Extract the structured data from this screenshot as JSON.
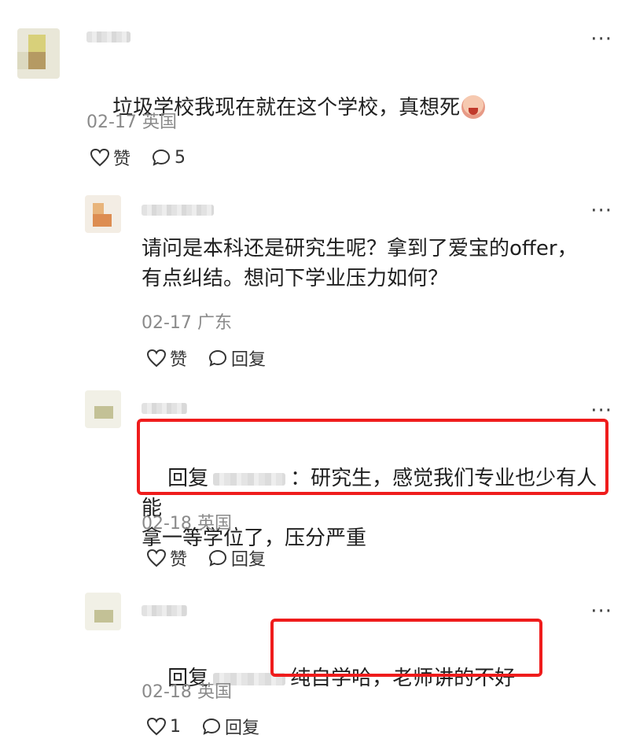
{
  "comments": [
    {
      "text": "垃圾学校我现在就在这个学校，真想死",
      "date": "02-17",
      "location": "英国",
      "like_label": "赞",
      "reply_count": "5",
      "more": "···"
    },
    {
      "text": "请问是本科还是研究生呢？拿到了爱宝的offer，\n有点纠结。想问下学业压力如何？",
      "date": "02-17",
      "location": "广东",
      "like_label": "赞",
      "reply_label": "回复",
      "more": "···"
    },
    {
      "reply_prefix": "回复",
      "reply_suffix": "：研究生，感觉我们专业也少有人能\n拿一等学位了，压分严重",
      "date": "02-18",
      "location": "英国",
      "like_label": "赞",
      "reply_label": "回复",
      "more": "···"
    },
    {
      "reply_prefix": "回复",
      "reply_suffix": "纯自学哈，老师讲的不好",
      "date": "02-18",
      "location": "英国",
      "like_count": "1",
      "reply_label": "回复",
      "more": "···"
    }
  ],
  "colors": {
    "highlight_box": "#ef1c1c",
    "meta_text": "#8a8a8a"
  }
}
